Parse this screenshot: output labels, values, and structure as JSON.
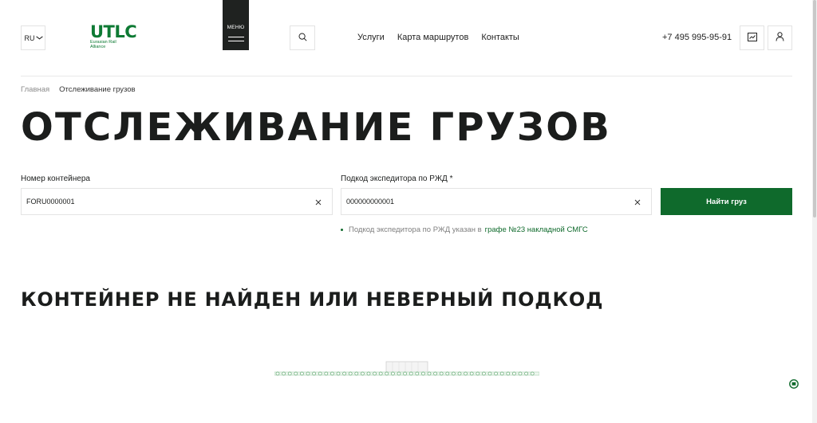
{
  "header": {
    "lang": "RU",
    "logo_word": "UTLC",
    "logo_sub": "Eurasian Rail Alliance",
    "menu_label": "МЕНЮ",
    "nav": [
      "Услуги",
      "Карта маршрутов",
      "Контакты"
    ],
    "phone": "+7 495 995-95-91"
  },
  "breadcrumb": {
    "home": "Главная",
    "current": "Отслеживание грузов"
  },
  "page_title": "ОТСЛЕЖИВАНИЕ ГРУЗОВ",
  "form": {
    "container_label": "Номер контейнера",
    "container_value": "FORU0000001",
    "code_label": "Подкод экспедитора по РЖД *",
    "code_value": "000000000001",
    "submit_label": "Найти груз",
    "hint_text": "Подкод экспедитора по РЖД указан в",
    "hint_link": "графе №23 накладной СМГС"
  },
  "result_title": "КОНТЕЙНЕР НЕ НАЙДЕН ИЛИ НЕВЕРНЫЙ ПОДКОД",
  "colors": {
    "brand_green": "#0f6a2c",
    "logo_green": "#0e7a34",
    "dark": "#1f2220"
  },
  "icons": {
    "search": "search-icon",
    "clear": "close-icon",
    "cabinet": "chart-icon",
    "profile": "user-icon",
    "chat": "chat-icon"
  }
}
